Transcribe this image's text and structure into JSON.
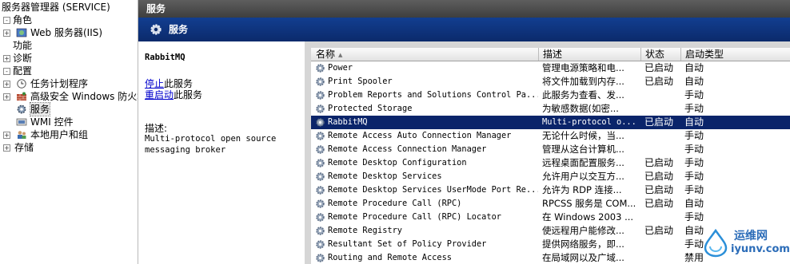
{
  "tree": {
    "root_label": "服务器管理器 (SERVICE)",
    "nodes": [
      {
        "label": "角色",
        "expander": "-"
      },
      {
        "label": "Web 服务器(IIS)",
        "expander": "+"
      },
      {
        "label": "功能",
        "expander": ""
      },
      {
        "label": "诊断",
        "expander": "+"
      },
      {
        "label": "配置",
        "expander": "-"
      },
      {
        "label": "任务计划程序",
        "expander": "+"
      },
      {
        "label": "高级安全 Windows 防火墙",
        "expander": "+"
      },
      {
        "label": "服务",
        "expander": ""
      },
      {
        "label": "WMI 控件",
        "expander": ""
      },
      {
        "label": "本地用户和组",
        "expander": "+"
      },
      {
        "label": "存储",
        "expander": "+"
      }
    ]
  },
  "window": {
    "title": "服务"
  },
  "header": {
    "title": "服务",
    "icon": "gear-icon"
  },
  "detail": {
    "service_name": "RabbitMQ",
    "stop_link": "停止",
    "stop_suffix": "此服务",
    "restart_link": "重启动",
    "restart_suffix": "此服务",
    "description_label": "描述:",
    "description": "Multi-protocol open source messaging broker"
  },
  "table": {
    "columns": [
      "名称",
      "描述",
      "状态",
      "启动类型"
    ],
    "rows": [
      {
        "name": "Power",
        "desc": "管理电源策略和电...",
        "status": "已启动",
        "start": "自动"
      },
      {
        "name": "Print Spooler",
        "desc": "将文件加载到内存...",
        "status": "已启动",
        "start": "自动"
      },
      {
        "name": "Problem Reports and Solutions Control Pa...",
        "desc": "此服务为查看、发...",
        "status": "",
        "start": "手动"
      },
      {
        "name": "Protected Storage",
        "desc": "为敏感数据(如密...",
        "status": "",
        "start": "手动"
      },
      {
        "name": "RabbitMQ",
        "desc": "Multi-protocol o...",
        "status": "已启动",
        "start": "自动",
        "selected": true
      },
      {
        "name": "Remote Access Auto Connection Manager",
        "desc": "无论什么时候，当...",
        "status": "",
        "start": "手动"
      },
      {
        "name": "Remote Access Connection Manager",
        "desc": "管理从这台计算机...",
        "status": "",
        "start": "手动"
      },
      {
        "name": "Remote Desktop Configuration",
        "desc": "远程桌面配置服务...",
        "status": "已启动",
        "start": "手动"
      },
      {
        "name": "Remote Desktop Services",
        "desc": "允许用户以交互方...",
        "status": "已启动",
        "start": "手动"
      },
      {
        "name": "Remote Desktop Services UserMode Port Re...",
        "desc": "允许为 RDP 连接...",
        "status": "已启动",
        "start": "手动"
      },
      {
        "name": "Remote Procedure Call (RPC)",
        "desc": "RPCSS 服务是 COM...",
        "status": "已启动",
        "start": "自动"
      },
      {
        "name": "Remote Procedure Call (RPC) Locator",
        "desc": "在 Windows 2003 ...",
        "status": "",
        "start": "手动"
      },
      {
        "name": "Remote Registry",
        "desc": "使远程用户能修改...",
        "status": "已启动",
        "start": "自动"
      },
      {
        "name": "Resultant Set of Policy Provider",
        "desc": "提供网络服务，即...",
        "status": "",
        "start": "手动"
      },
      {
        "name": "Routing and Remote Access",
        "desc": "在局域网以及广域...",
        "status": "",
        "start": "禁用"
      }
    ]
  },
  "watermark": {
    "line1": "运维网",
    "line2": "iyunv.com"
  },
  "colors": {
    "selection": "#0a246a",
    "header_blue": "#0b2a6b",
    "link": "#0000cc"
  }
}
